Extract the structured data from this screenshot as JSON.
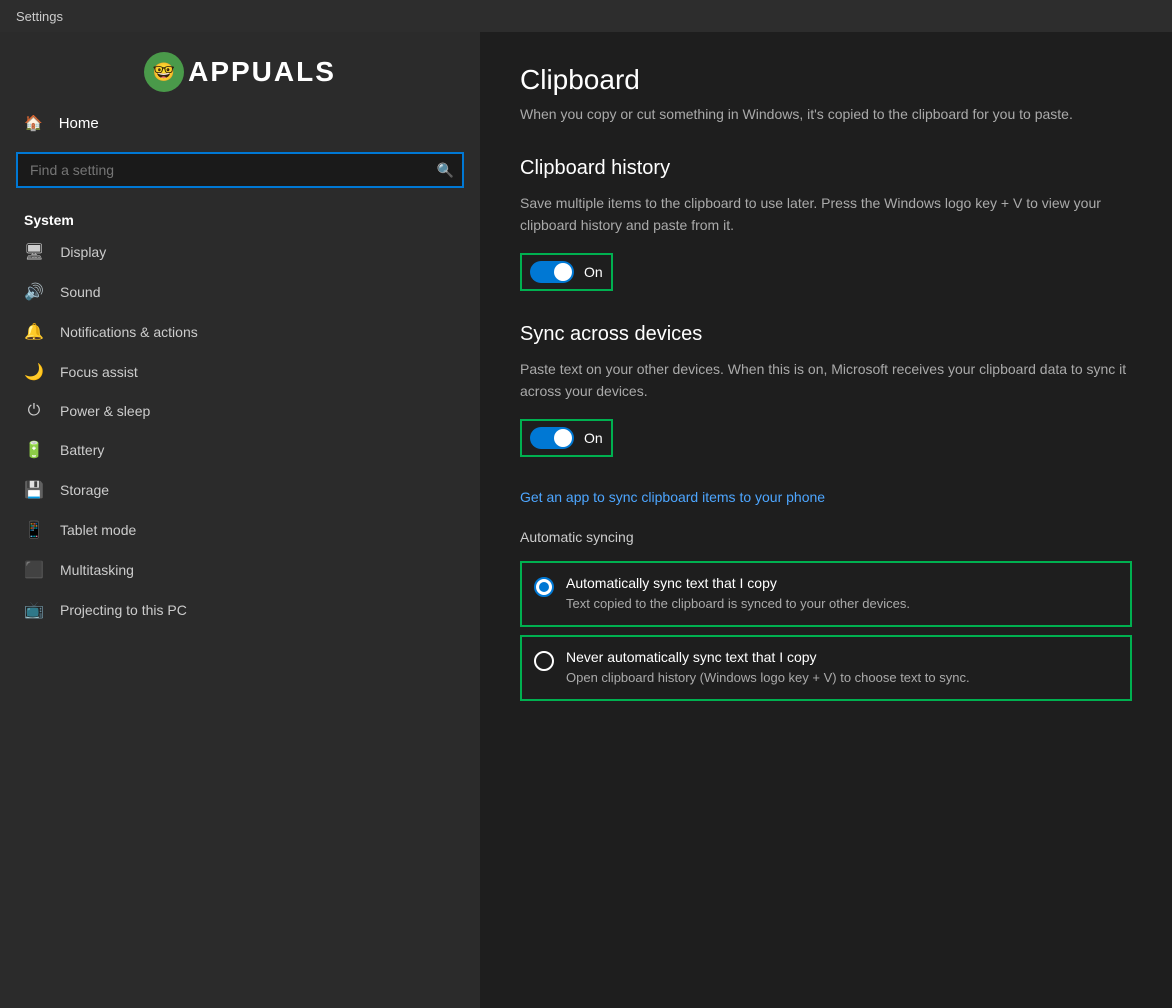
{
  "titleBar": {
    "label": "Settings"
  },
  "sidebar": {
    "logoText": "APPUALS",
    "homeLabel": "Home",
    "searchPlaceholder": "Find a setting",
    "systemLabel": "System",
    "navItems": [
      {
        "id": "display",
        "icon": "🖥",
        "label": "Display"
      },
      {
        "id": "sound",
        "icon": "🔊",
        "label": "Sound"
      },
      {
        "id": "notifications",
        "icon": "🔔",
        "label": "Notifications & actions"
      },
      {
        "id": "focus-assist",
        "icon": "🌙",
        "label": "Focus assist"
      },
      {
        "id": "power-sleep",
        "icon": "⏻",
        "label": "Power & sleep"
      },
      {
        "id": "battery",
        "icon": "🔋",
        "label": "Battery"
      },
      {
        "id": "storage",
        "icon": "💾",
        "label": "Storage"
      },
      {
        "id": "tablet-mode",
        "icon": "📱",
        "label": "Tablet mode"
      },
      {
        "id": "multitasking",
        "icon": "⬛",
        "label": "Multitasking"
      },
      {
        "id": "projecting",
        "icon": "📺",
        "label": "Projecting to this PC"
      }
    ]
  },
  "content": {
    "pageTitle": "Clipboard",
    "pageSubtitle": "When you copy or cut something in Windows, it's copied to the clipboard for you to paste.",
    "clipboardHistory": {
      "title": "Clipboard history",
      "description": "Save multiple items to the clipboard to use later. Press the Windows logo key + V to view your clipboard history and paste from it.",
      "toggleState": "On"
    },
    "syncAcrossDevices": {
      "title": "Sync across devices",
      "description": "Paste text on your other devices. When this is on, Microsoft receives your clipboard data to sync it across your devices.",
      "toggleState": "On",
      "linkText": "Get an app to sync clipboard items to your phone"
    },
    "automaticSyncing": {
      "title": "Automatic syncing",
      "options": [
        {
          "id": "auto-sync",
          "label": "Automatically sync text that I copy",
          "description": "Text copied to the clipboard is synced to your other devices.",
          "selected": true
        },
        {
          "id": "never-sync",
          "label": "Never automatically sync text that I copy",
          "description": "Open clipboard history (Windows logo key + V) to choose text to sync.",
          "selected": false
        }
      ]
    }
  }
}
